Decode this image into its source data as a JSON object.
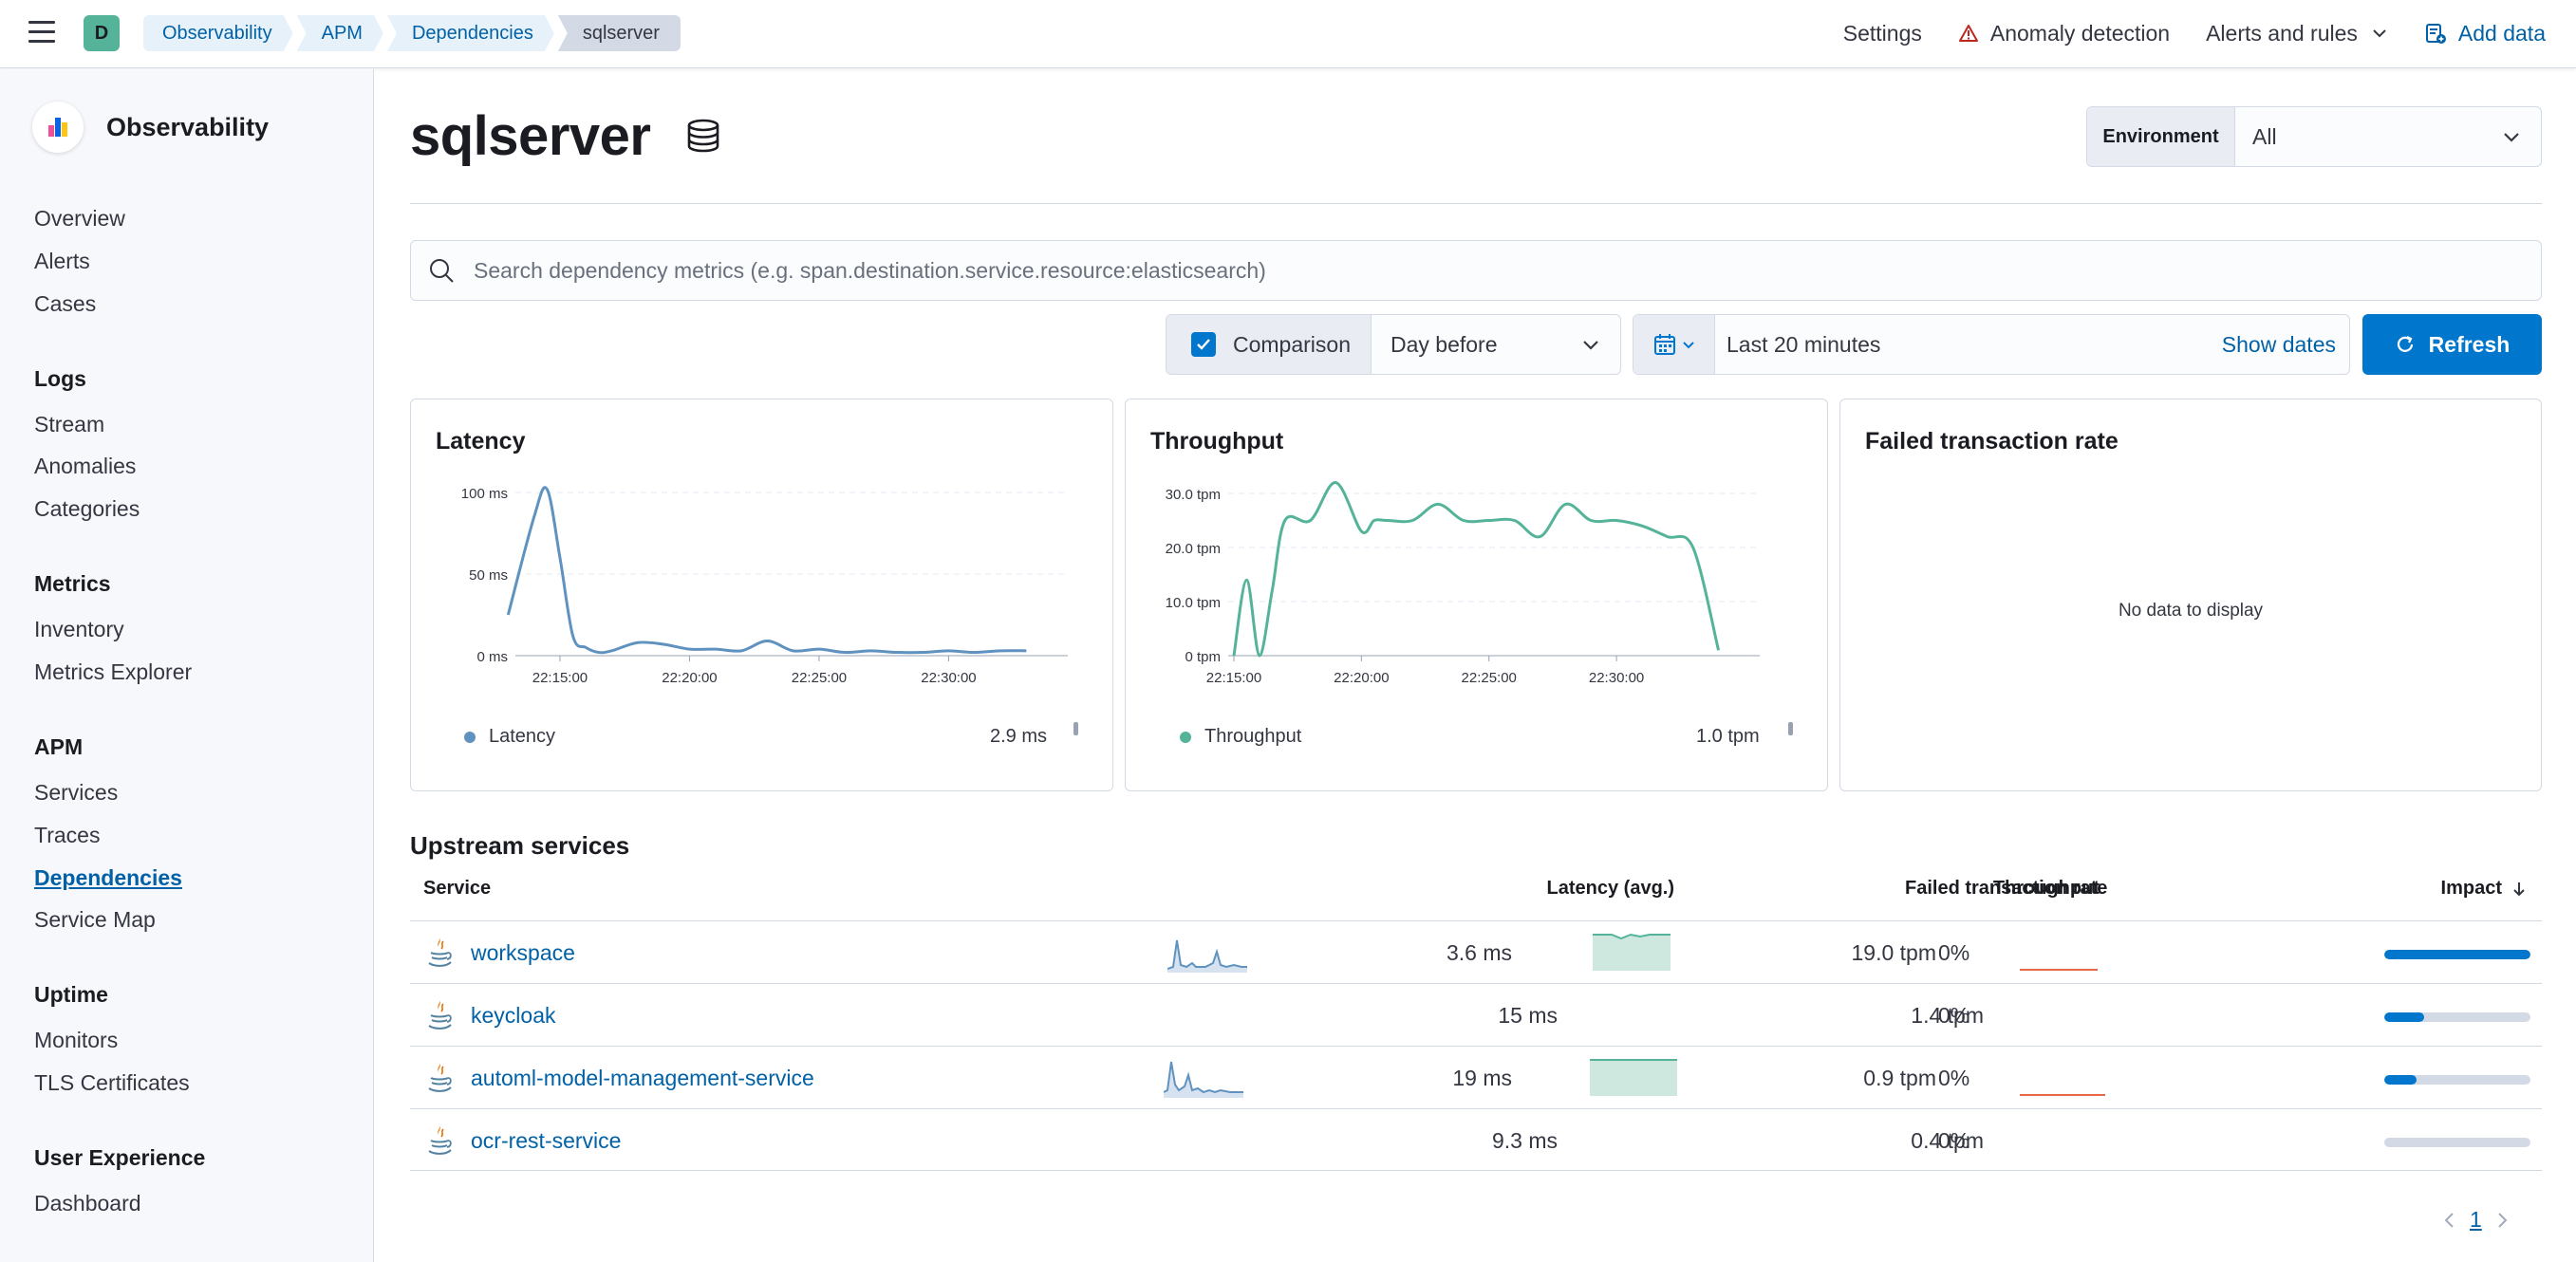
{
  "topbar": {
    "space_initial": "D",
    "breadcrumbs": [
      "Observability",
      "APM",
      "Dependencies",
      "sqlserver"
    ],
    "settings": "Settings",
    "anomaly": "Anomaly detection",
    "alerts": "Alerts and rules",
    "add_data": "Add data"
  },
  "sidebar": {
    "title": "Observability",
    "top_items": [
      "Overview",
      "Alerts",
      "Cases"
    ],
    "sections": [
      {
        "title": "Logs",
        "items": [
          "Stream",
          "Anomalies",
          "Categories"
        ]
      },
      {
        "title": "Metrics",
        "items": [
          "Inventory",
          "Metrics Explorer"
        ]
      },
      {
        "title": "APM",
        "items": [
          "Services",
          "Traces",
          "Dependencies",
          "Service Map"
        ]
      },
      {
        "title": "Uptime",
        "items": [
          "Monitors",
          "TLS Certificates"
        ]
      },
      {
        "title": "User Experience",
        "items": [
          "Dashboard"
        ]
      }
    ],
    "active_item": "Dependencies"
  },
  "page": {
    "title": "sqlserver",
    "environment_label": "Environment",
    "environment_value": "All",
    "search_placeholder": "Search dependency metrics (e.g. span.destination.service.resource:elasticsearch)",
    "comparison_label": "Comparison",
    "comparison_checked": true,
    "comparison_value": "Day before",
    "date_range": "Last 20 minutes",
    "show_dates": "Show dates",
    "refresh": "Refresh"
  },
  "panels": {
    "latency": {
      "title": "Latency",
      "legend": "Latency",
      "value": "2.9 ms"
    },
    "throughput": {
      "title": "Throughput",
      "legend": "Throughput",
      "value": "1.0 tpm"
    },
    "failed": {
      "title": "Failed transaction rate",
      "empty": "No data to display"
    }
  },
  "chart_data": [
    {
      "type": "line",
      "title": "Latency",
      "x": [
        "22:13:00",
        "22:14:00",
        "22:14:30",
        "22:15:00",
        "22:15:30",
        "22:16:00",
        "22:16:30",
        "22:17:00",
        "22:18:00",
        "22:19:00",
        "22:20:00",
        "22:21:00",
        "22:22:00",
        "22:23:00",
        "22:24:00",
        "22:25:00",
        "22:26:00",
        "22:27:00",
        "22:28:00",
        "22:29:00",
        "22:30:00",
        "22:31:00",
        "22:32:00",
        "22:33:00"
      ],
      "series": [
        {
          "name": "Latency",
          "values": [
            25,
            85,
            102,
            60,
            12,
            5,
            2,
            3,
            8,
            7,
            4,
            4,
            3,
            9,
            3,
            4,
            2,
            3,
            2,
            2,
            3,
            2,
            3,
            3
          ]
        }
      ],
      "xticks": [
        "22:15:00",
        "22:20:00",
        "22:25:00",
        "22:30:00"
      ],
      "yticks": [
        "0 ms",
        "50 ms",
        "100 ms"
      ],
      "ylim": [
        0,
        100
      ],
      "color": "#6092c0"
    },
    {
      "type": "line",
      "title": "Throughput",
      "x": [
        "22:15:00",
        "22:15:30",
        "22:16:00",
        "22:16:30",
        "22:17:00",
        "22:18:00",
        "22:19:00",
        "22:20:00",
        "22:20:30",
        "22:21:00",
        "22:22:00",
        "22:23:00",
        "22:24:00",
        "22:25:00",
        "22:26:00",
        "22:27:00",
        "22:28:00",
        "22:29:00",
        "22:30:00",
        "22:31:00",
        "22:32:00",
        "22:33:00",
        "22:34:00"
      ],
      "series": [
        {
          "name": "Throughput",
          "values": [
            0,
            14,
            0,
            12,
            25,
            25,
            32,
            23,
            25,
            25,
            25,
            28,
            25,
            25,
            25,
            22,
            28,
            25,
            25,
            24,
            22,
            20,
            1
          ]
        }
      ],
      "xticks": [
        "22:15:00",
        "22:20:00",
        "22:25:00",
        "22:30:00"
      ],
      "yticks": [
        "0 tpm",
        "10.0 tpm",
        "20.0 tpm",
        "30.0 tpm"
      ],
      "ylim": [
        0,
        30
      ],
      "color": "#54b399"
    }
  ],
  "upstream": {
    "title": "Upstream services",
    "columns": [
      "Service",
      "Latency (avg.)",
      "Throughput",
      "Failed transaction rate",
      "Impact"
    ],
    "rows": [
      {
        "service": "workspace",
        "latency": "3.6 ms",
        "throughput": "19.0 tpm",
        "failed": "0%",
        "impact": 1.0,
        "spark": true
      },
      {
        "service": "keycloak",
        "latency": "15 ms",
        "throughput": "1.4 tpm",
        "failed": "0%",
        "impact": 0.27,
        "spark": false
      },
      {
        "service": "automl-model-management-service",
        "latency": "19 ms",
        "throughput": "0.9 tpm",
        "failed": "0%",
        "impact": 0.22,
        "spark": true
      },
      {
        "service": "ocr-rest-service",
        "latency": "9.3 ms",
        "throughput": "0.4 tpm",
        "failed": "0%",
        "impact": 0.0,
        "spark": false
      }
    ]
  },
  "pagination": {
    "current": "1"
  }
}
